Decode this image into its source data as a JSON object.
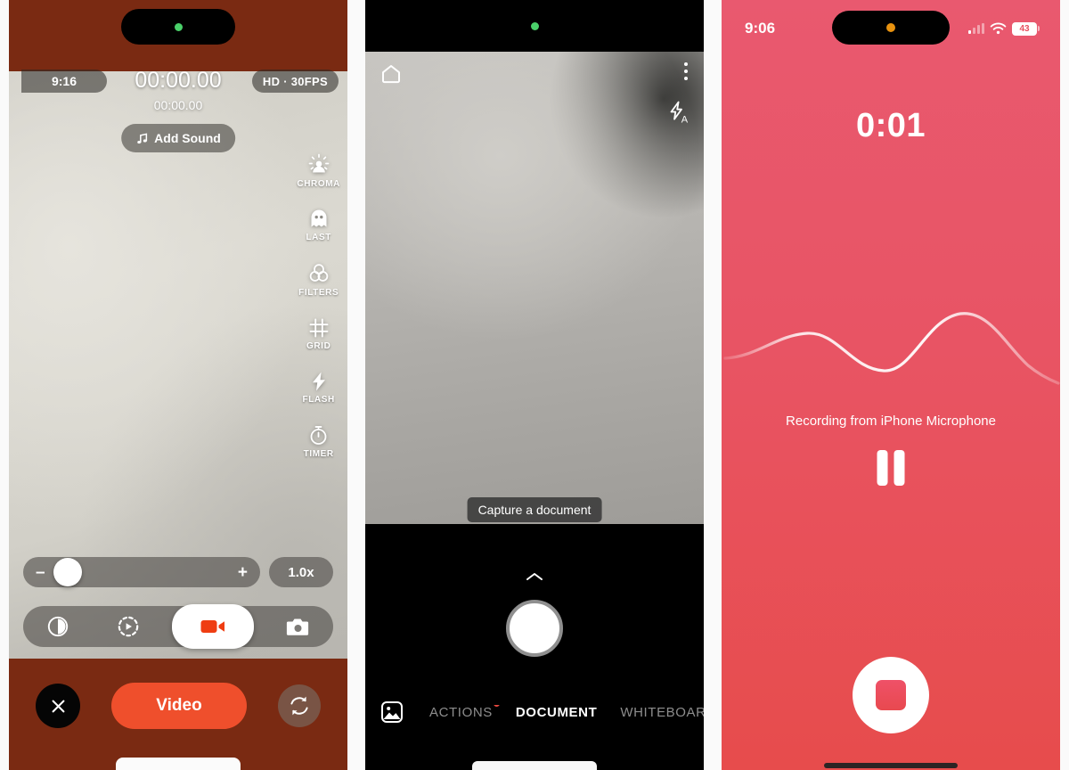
{
  "panels": {
    "video": {
      "name": "Video camera capture screen",
      "status_time": "9:16",
      "quality_badge": "HD · 30FPS",
      "timer_main": "00:00.00",
      "timer_sub": "00:00.00",
      "add_sound_label": "Add Sound",
      "tools": [
        {
          "label": "CHROMA",
          "icon": "chroma-icon"
        },
        {
          "label": "LAST",
          "icon": "ghost-icon"
        },
        {
          "label": "FILTERS",
          "icon": "filters-icon"
        },
        {
          "label": "GRID",
          "icon": "grid-icon"
        },
        {
          "label": "FLASH",
          "icon": "flash-icon"
        },
        {
          "label": "TIMER",
          "icon": "timer-icon"
        }
      ],
      "zoom": {
        "minus": "–",
        "plus": "+",
        "value": "1.0x"
      },
      "modes": [
        {
          "name": "slow-motion",
          "icon": "half-circle-icon",
          "active": false
        },
        {
          "name": "timelapse",
          "icon": "dashed-play-icon",
          "active": false
        },
        {
          "name": "video",
          "icon": "video-camera-icon",
          "active": true
        },
        {
          "name": "photo",
          "icon": "camera-icon",
          "active": false
        }
      ],
      "record_label": "Video",
      "close_label": "×",
      "accent_color": "#ef4f2c",
      "chrome_color": "#7a2a12"
    },
    "document": {
      "name": "Document scanner capture screen",
      "tooltip": "Capture a document",
      "tabs": [
        {
          "label": "ACTIONS",
          "active": false,
          "badge": true
        },
        {
          "label": "DOCUMENT",
          "active": true,
          "badge": false
        },
        {
          "label": "WHITEBOARD",
          "active": false,
          "badge": false
        }
      ],
      "icons": {
        "home": "home-icon",
        "menu": "three-dot-menu-icon",
        "flash": "flash-auto-icon",
        "gallery": "gallery-icon",
        "expand": "chevron-up-icon",
        "shutter": "shutter-button"
      },
      "badge_color": "#e8483f"
    },
    "audio": {
      "name": "Voice recorder recording screen",
      "status_time": "9:06",
      "battery_level": "43",
      "timer": "0:01",
      "source_label": "Recording from iPhone Microphone",
      "pause_label": "Pause",
      "stop_label": "Stop",
      "accent_color": "#e8505f"
    }
  }
}
